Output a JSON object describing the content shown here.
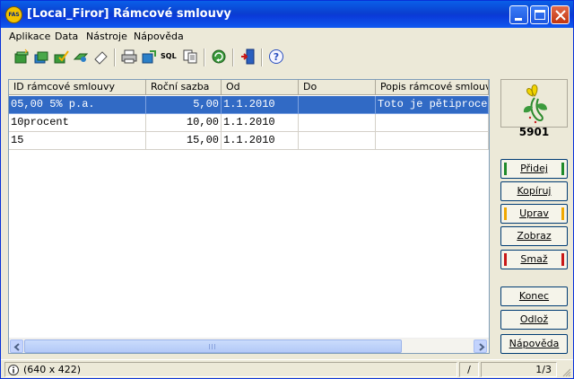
{
  "window": {
    "title": "[Local_Firor] Rámcové smlouvy",
    "app_icon_text": "FAS"
  },
  "menu": [
    "Aplikace",
    "Data",
    "Nástroje",
    "Nápověda"
  ],
  "toolbar": {
    "icons": [
      "add-record-icon",
      "copy-record-icon",
      "edit-record-icon",
      "view-record-icon",
      "erase-icon",
      "print-icon",
      "export-icon",
      "sql-icon",
      "copy-document-icon",
      "refresh-icon",
      "exit-door-icon",
      "help-icon"
    ],
    "sql_label": "SQL"
  },
  "table": {
    "columns": [
      "ID rámcové smlouvy",
      "Roční sazba",
      "Od",
      "Do",
      "Popis rámcové smlouvy"
    ],
    "rows": [
      {
        "id": "05,00 5% p.a.",
        "rate": "5,00",
        "from": "1.1.2010",
        "to": "",
        "description": "Toto je pětiprocen",
        "selected": true
      },
      {
        "id": "10procent",
        "rate": "10,00",
        "from": "1.1.2010",
        "to": "",
        "description": "",
        "selected": false
      },
      {
        "id": "15",
        "rate": "15,00",
        "from": "1.1.2010",
        "to": "",
        "description": "",
        "selected": false
      }
    ]
  },
  "panel": {
    "user_id": "5901",
    "buttons": [
      {
        "label": "Přidej",
        "accent": "#1f8a2a"
      },
      {
        "label": "Kopíruj",
        "accent": ""
      },
      {
        "label": "Uprav",
        "accent": "#f0a800"
      },
      {
        "label": "Zobraz",
        "accent": ""
      },
      {
        "label": "Smaž",
        "accent": "#c81818"
      },
      {
        "label": "Konec",
        "accent": ""
      },
      {
        "label": "Odlož",
        "accent": ""
      },
      {
        "label": "Nápověda",
        "accent": ""
      }
    ]
  },
  "status": {
    "info": "(640 x 422)",
    "mid": "/",
    "page": "1/3"
  },
  "colors": {
    "title_bar": "#0a46d8",
    "selection": "#316ac5",
    "window_bg": "#ece9d8"
  }
}
